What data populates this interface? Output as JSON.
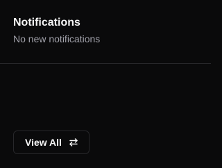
{
  "notifications": {
    "title": "Notifications",
    "empty_message": "No new notifications",
    "view_all_label": "View All",
    "view_all_icon": "swap-arrows-icon"
  },
  "colors": {
    "background": "#0a0a0b",
    "border": "#27272a",
    "text_primary": "#f5f5f5",
    "text_muted": "#a1a1aa"
  }
}
